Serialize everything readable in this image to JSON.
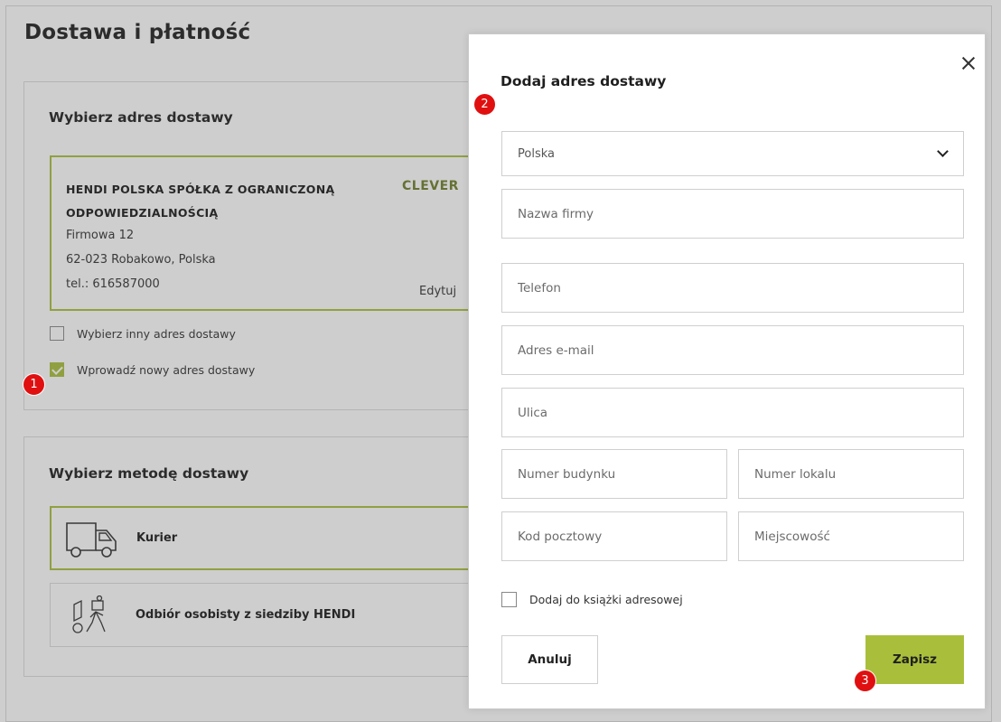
{
  "page": {
    "title": "Dostawa i płatność"
  },
  "address_section": {
    "heading": "Wybierz adres dostawy",
    "card": {
      "name": "HENDI POLSKA SPÓŁKA Z OGRANICZONĄ ODPOWIEDZIALNOŚCIĄ",
      "street": "Firmowa 12",
      "city": "62-023 Robakowo, Polska",
      "phone": "tel.: 616587000",
      "logo": "CLEVER",
      "edit_label": "Edytuj"
    },
    "options": [
      {
        "label": "Wybierz inny adres dostawy",
        "checked": false
      },
      {
        "label": "Wprowadź nowy adres dostawy",
        "checked": true
      }
    ]
  },
  "method_section": {
    "heading": "Wybierz metodę dostawy",
    "methods": [
      {
        "label": "Kurier",
        "icon": "truck-icon",
        "selected": true
      },
      {
        "label": "Odbiór osobisty z siedziby HENDI",
        "icon": "person-carrying-box-icon",
        "selected": false
      }
    ]
  },
  "modal": {
    "title": "Dodaj adres dostawy",
    "country_select": {
      "value": "Polska"
    },
    "fields": {
      "company": "Nazwa firmy",
      "phone": "Telefon",
      "email": "Adres e-mail",
      "street": "Ulica",
      "building": "Numer budynku",
      "apartment": "Numer lokalu",
      "postal": "Kod pocztowy",
      "city": "Miejscowość"
    },
    "address_book_label": "Dodaj do książki adresowej",
    "cancel_label": "Anuluj",
    "save_label": "Zapisz"
  },
  "markers": [
    "1",
    "2",
    "3"
  ],
  "colors": {
    "accent": "#a9bf3b",
    "marker": "#e01010"
  }
}
